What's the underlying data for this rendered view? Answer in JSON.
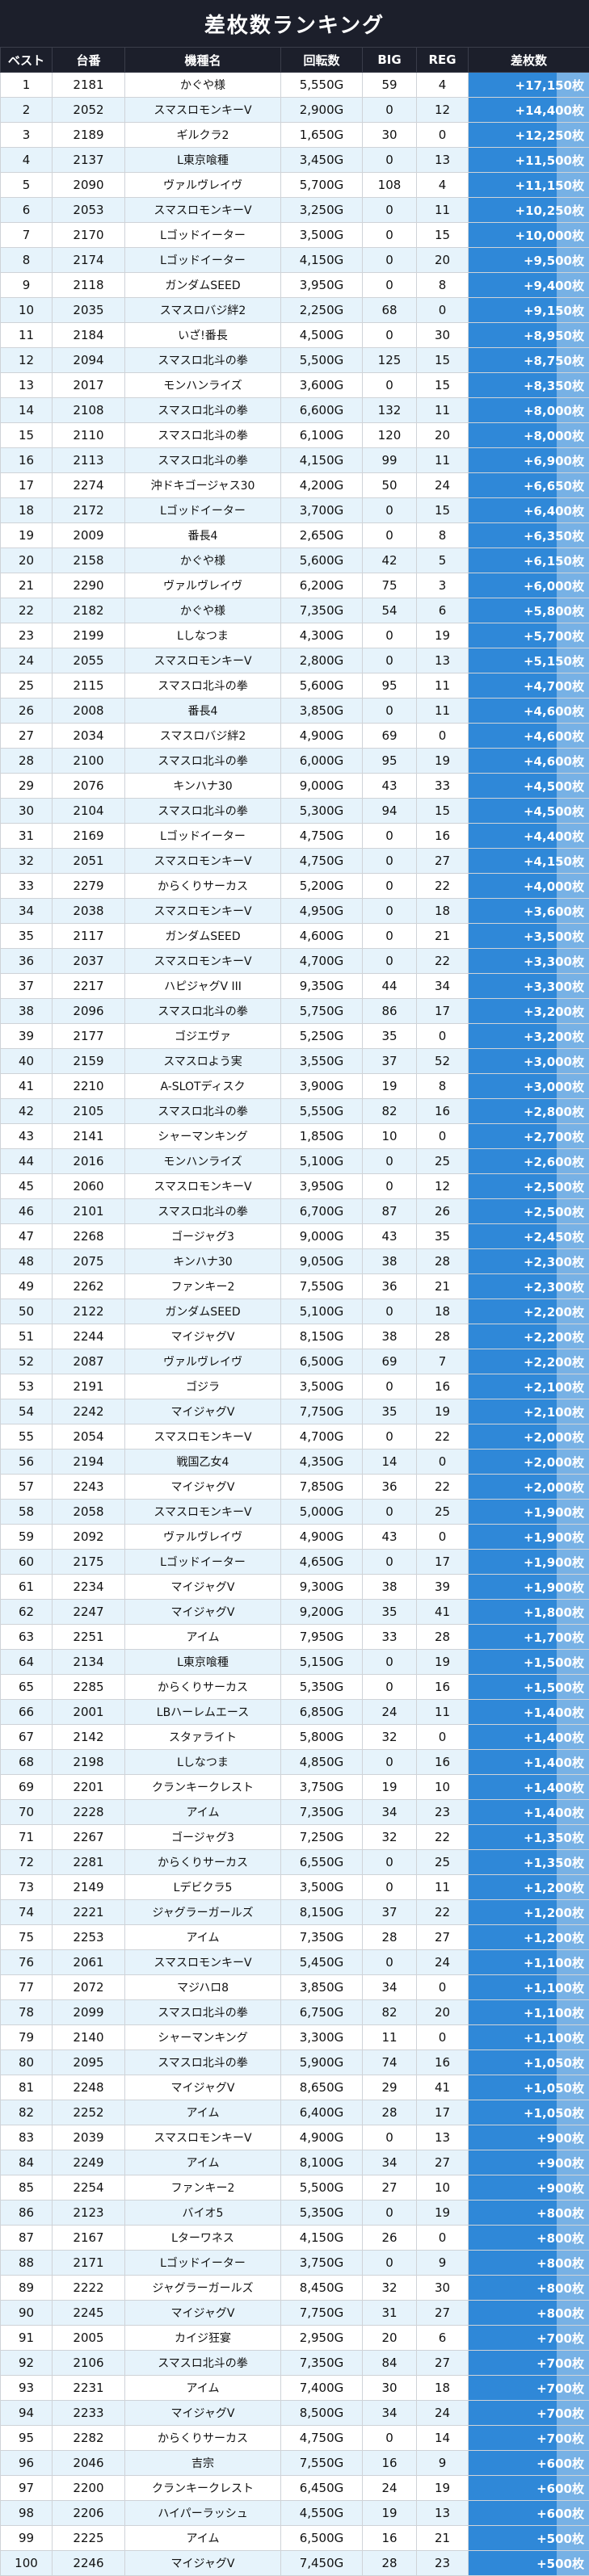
{
  "title": "差枚数ランキング",
  "columns": [
    "ベスト",
    "台番",
    "機種名",
    "回転数",
    "BIG",
    "REG",
    "差枚数"
  ],
  "rows": [
    [
      "1",
      "2181",
      "かぐや様",
      "5,550G",
      "59",
      "4",
      "+17,150枚"
    ],
    [
      "2",
      "2052",
      "スマスロモンキーV",
      "2,900G",
      "0",
      "12",
      "+14,400枚"
    ],
    [
      "3",
      "2189",
      "ギルクラ2",
      "1,650G",
      "30",
      "0",
      "+12,250枚"
    ],
    [
      "4",
      "2137",
      "L東京喰種",
      "3,450G",
      "0",
      "13",
      "+11,500枚"
    ],
    [
      "5",
      "2090",
      "ヴァルヴレイヴ",
      "5,700G",
      "108",
      "4",
      "+11,150枚"
    ],
    [
      "6",
      "2053",
      "スマスロモンキーV",
      "3,250G",
      "0",
      "11",
      "+10,250枚"
    ],
    [
      "7",
      "2170",
      "Lゴッドイーター",
      "3,500G",
      "0",
      "15",
      "+10,000枚"
    ],
    [
      "8",
      "2174",
      "Lゴッドイーター",
      "4,150G",
      "0",
      "20",
      "+9,500枚"
    ],
    [
      "9",
      "2118",
      "ガンダムSEED",
      "3,950G",
      "0",
      "8",
      "+9,400枚"
    ],
    [
      "10",
      "2035",
      "スマスロバジ絆2",
      "2,250G",
      "68",
      "0",
      "+9,150枚"
    ],
    [
      "11",
      "2184",
      "いざ!番長",
      "4,500G",
      "0",
      "30",
      "+8,950枚"
    ],
    [
      "12",
      "2094",
      "スマスロ北斗の拳",
      "5,500G",
      "125",
      "15",
      "+8,750枚"
    ],
    [
      "13",
      "2017",
      "モンハンライズ",
      "3,600G",
      "0",
      "15",
      "+8,350枚"
    ],
    [
      "14",
      "2108",
      "スマスロ北斗の拳",
      "6,600G",
      "132",
      "11",
      "+8,000枚"
    ],
    [
      "15",
      "2110",
      "スマスロ北斗の拳",
      "6,100G",
      "120",
      "20",
      "+8,000枚"
    ],
    [
      "16",
      "2113",
      "スマスロ北斗の拳",
      "4,150G",
      "99",
      "11",
      "+6,900枚"
    ],
    [
      "17",
      "2274",
      "沖ドキゴージャス30",
      "4,200G",
      "50",
      "24",
      "+6,650枚"
    ],
    [
      "18",
      "2172",
      "Lゴッドイーター",
      "3,700G",
      "0",
      "15",
      "+6,400枚"
    ],
    [
      "19",
      "2009",
      "番長4",
      "2,650G",
      "0",
      "8",
      "+6,350枚"
    ],
    [
      "20",
      "2158",
      "かぐや様",
      "5,600G",
      "42",
      "5",
      "+6,150枚"
    ],
    [
      "21",
      "2290",
      "ヴァルヴレイヴ",
      "6,200G",
      "75",
      "3",
      "+6,000枚"
    ],
    [
      "22",
      "2182",
      "かぐや様",
      "7,350G",
      "54",
      "6",
      "+5,800枚"
    ],
    [
      "23",
      "2199",
      "Lしなつま",
      "4,300G",
      "0",
      "19",
      "+5,700枚"
    ],
    [
      "24",
      "2055",
      "スマスロモンキーV",
      "2,800G",
      "0",
      "13",
      "+5,150枚"
    ],
    [
      "25",
      "2115",
      "スマスロ北斗の拳",
      "5,600G",
      "95",
      "11",
      "+4,700枚"
    ],
    [
      "26",
      "2008",
      "番長4",
      "3,850G",
      "0",
      "11",
      "+4,600枚"
    ],
    [
      "27",
      "2034",
      "スマスロバジ絆2",
      "4,900G",
      "69",
      "0",
      "+4,600枚"
    ],
    [
      "28",
      "2100",
      "スマスロ北斗の拳",
      "6,000G",
      "95",
      "19",
      "+4,600枚"
    ],
    [
      "29",
      "2076",
      "キンハナ30",
      "9,000G",
      "43",
      "33",
      "+4,500枚"
    ],
    [
      "30",
      "2104",
      "スマスロ北斗の拳",
      "5,300G",
      "94",
      "15",
      "+4,500枚"
    ],
    [
      "31",
      "2169",
      "Lゴッドイーター",
      "4,750G",
      "0",
      "16",
      "+4,400枚"
    ],
    [
      "32",
      "2051",
      "スマスロモンキーV",
      "4,750G",
      "0",
      "27",
      "+4,150枚"
    ],
    [
      "33",
      "2279",
      "からくりサーカス",
      "5,200G",
      "0",
      "22",
      "+4,000枚"
    ],
    [
      "34",
      "2038",
      "スマスロモンキーV",
      "4,950G",
      "0",
      "18",
      "+3,600枚"
    ],
    [
      "35",
      "2117",
      "ガンダムSEED",
      "4,600G",
      "0",
      "21",
      "+3,500枚"
    ],
    [
      "36",
      "2037",
      "スマスロモンキーV",
      "4,700G",
      "0",
      "22",
      "+3,300枚"
    ],
    [
      "37",
      "2217",
      "ハピジャグV III",
      "9,350G",
      "44",
      "34",
      "+3,300枚"
    ],
    [
      "38",
      "2096",
      "スマスロ北斗の拳",
      "5,750G",
      "86",
      "17",
      "+3,200枚"
    ],
    [
      "39",
      "2177",
      "ゴジエヴァ",
      "5,250G",
      "35",
      "0",
      "+3,200枚"
    ],
    [
      "40",
      "2159",
      "スマスロよう実",
      "3,550G",
      "37",
      "52",
      "+3,000枚"
    ],
    [
      "41",
      "2210",
      "A-SLOTディスク",
      "3,900G",
      "19",
      "8",
      "+3,000枚"
    ],
    [
      "42",
      "2105",
      "スマスロ北斗の拳",
      "5,550G",
      "82",
      "16",
      "+2,800枚"
    ],
    [
      "43",
      "2141",
      "シャーマンキング",
      "1,850G",
      "10",
      "0",
      "+2,700枚"
    ],
    [
      "44",
      "2016",
      "モンハンライズ",
      "5,100G",
      "0",
      "25",
      "+2,600枚"
    ],
    [
      "45",
      "2060",
      "スマスロモンキーV",
      "3,950G",
      "0",
      "12",
      "+2,500枚"
    ],
    [
      "46",
      "2101",
      "スマスロ北斗の拳",
      "6,700G",
      "87",
      "26",
      "+2,500枚"
    ],
    [
      "47",
      "2268",
      "ゴージャグ3",
      "9,000G",
      "43",
      "35",
      "+2,450枚"
    ],
    [
      "48",
      "2075",
      "キンハナ30",
      "9,050G",
      "38",
      "28",
      "+2,300枚"
    ],
    [
      "49",
      "2262",
      "ファンキー2",
      "7,550G",
      "36",
      "21",
      "+2,300枚"
    ],
    [
      "50",
      "2122",
      "ガンダムSEED",
      "5,100G",
      "0",
      "18",
      "+2,200枚"
    ],
    [
      "51",
      "2244",
      "マイジャグV",
      "8,150G",
      "38",
      "28",
      "+2,200枚"
    ],
    [
      "52",
      "2087",
      "ヴァルヴレイヴ",
      "6,500G",
      "69",
      "7",
      "+2,200枚"
    ],
    [
      "53",
      "2191",
      "ゴジラ",
      "3,500G",
      "0",
      "16",
      "+2,100枚"
    ],
    [
      "54",
      "2242",
      "マイジャグV",
      "7,750G",
      "35",
      "19",
      "+2,100枚"
    ],
    [
      "55",
      "2054",
      "スマスロモンキーV",
      "4,700G",
      "0",
      "22",
      "+2,000枚"
    ],
    [
      "56",
      "2194",
      "戦国乙女4",
      "4,350G",
      "14",
      "0",
      "+2,000枚"
    ],
    [
      "57",
      "2243",
      "マイジャグV",
      "7,850G",
      "36",
      "22",
      "+2,000枚"
    ],
    [
      "58",
      "2058",
      "スマスロモンキーV",
      "5,000G",
      "0",
      "25",
      "+1,900枚"
    ],
    [
      "59",
      "2092",
      "ヴァルヴレイヴ",
      "4,900G",
      "43",
      "0",
      "+1,900枚"
    ],
    [
      "60",
      "2175",
      "Lゴッドイーター",
      "4,650G",
      "0",
      "17",
      "+1,900枚"
    ],
    [
      "61",
      "2234",
      "マイジャグV",
      "9,300G",
      "38",
      "39",
      "+1,900枚"
    ],
    [
      "62",
      "2247",
      "マイジャグV",
      "9,200G",
      "35",
      "41",
      "+1,800枚"
    ],
    [
      "63",
      "2251",
      "アイム",
      "7,950G",
      "33",
      "28",
      "+1,700枚"
    ],
    [
      "64",
      "2134",
      "L東京喰種",
      "5,150G",
      "0",
      "19",
      "+1,500枚"
    ],
    [
      "65",
      "2285",
      "からくりサーカス",
      "5,350G",
      "0",
      "16",
      "+1,500枚"
    ],
    [
      "66",
      "2001",
      "LBハーレムエース",
      "6,850G",
      "24",
      "11",
      "+1,400枚"
    ],
    [
      "67",
      "2142",
      "スタァライト",
      "5,800G",
      "32",
      "0",
      "+1,400枚"
    ],
    [
      "68",
      "2198",
      "Lしなつま",
      "4,850G",
      "0",
      "16",
      "+1,400枚"
    ],
    [
      "69",
      "2201",
      "クランキークレスト",
      "3,750G",
      "19",
      "10",
      "+1,400枚"
    ],
    [
      "70",
      "2228",
      "アイム",
      "7,350G",
      "34",
      "23",
      "+1,400枚"
    ],
    [
      "71",
      "2267",
      "ゴージャグ3",
      "7,250G",
      "32",
      "22",
      "+1,350枚"
    ],
    [
      "72",
      "2281",
      "からくりサーカス",
      "6,550G",
      "0",
      "25",
      "+1,350枚"
    ],
    [
      "73",
      "2149",
      "Lデビクラ5",
      "3,500G",
      "0",
      "11",
      "+1,200枚"
    ],
    [
      "74",
      "2221",
      "ジャグラーガールズ",
      "8,150G",
      "37",
      "22",
      "+1,200枚"
    ],
    [
      "75",
      "2253",
      "アイム",
      "7,350G",
      "28",
      "27",
      "+1,200枚"
    ],
    [
      "76",
      "2061",
      "スマスロモンキーV",
      "5,450G",
      "0",
      "24",
      "+1,100枚"
    ],
    [
      "77",
      "2072",
      "マジハロ8",
      "3,850G",
      "34",
      "0",
      "+1,100枚"
    ],
    [
      "78",
      "2099",
      "スマスロ北斗の拳",
      "6,750G",
      "82",
      "20",
      "+1,100枚"
    ],
    [
      "79",
      "2140",
      "シャーマンキング",
      "3,300G",
      "11",
      "0",
      "+1,100枚"
    ],
    [
      "80",
      "2095",
      "スマスロ北斗の拳",
      "5,900G",
      "74",
      "16",
      "+1,050枚"
    ],
    [
      "81",
      "2248",
      "マイジャグV",
      "8,650G",
      "29",
      "41",
      "+1,050枚"
    ],
    [
      "82",
      "2252",
      "アイム",
      "6,400G",
      "28",
      "17",
      "+1,050枚"
    ],
    [
      "83",
      "2039",
      "スマスロモンキーV",
      "4,900G",
      "0",
      "13",
      "+900枚"
    ],
    [
      "84",
      "2249",
      "アイム",
      "8,100G",
      "34",
      "27",
      "+900枚"
    ],
    [
      "85",
      "2254",
      "ファンキー2",
      "5,500G",
      "27",
      "10",
      "+900枚"
    ],
    [
      "86",
      "2123",
      "バイオ5",
      "5,350G",
      "0",
      "19",
      "+800枚"
    ],
    [
      "87",
      "2167",
      "Lターワネス",
      "4,150G",
      "26",
      "0",
      "+800枚"
    ],
    [
      "88",
      "2171",
      "Lゴッドイーター",
      "3,750G",
      "0",
      "9",
      "+800枚"
    ],
    [
      "89",
      "2222",
      "ジャグラーガールズ",
      "8,450G",
      "32",
      "30",
      "+800枚"
    ],
    [
      "90",
      "2245",
      "マイジャグV",
      "7,750G",
      "31",
      "27",
      "+800枚"
    ],
    [
      "91",
      "2005",
      "カイジ狂宴",
      "2,950G",
      "20",
      "6",
      "+700枚"
    ],
    [
      "92",
      "2106",
      "スマスロ北斗の拳",
      "7,350G",
      "84",
      "27",
      "+700枚"
    ],
    [
      "93",
      "2231",
      "アイム",
      "7,400G",
      "30",
      "18",
      "+700枚"
    ],
    [
      "94",
      "2233",
      "マイジャグV",
      "8,500G",
      "34",
      "24",
      "+700枚"
    ],
    [
      "95",
      "2282",
      "からくりサーカス",
      "4,750G",
      "0",
      "14",
      "+700枚"
    ],
    [
      "96",
      "2046",
      "吉宗",
      "7,550G",
      "16",
      "9",
      "+600枚"
    ],
    [
      "97",
      "2200",
      "クランキークレスト",
      "6,450G",
      "24",
      "19",
      "+600枚"
    ],
    [
      "98",
      "2206",
      "ハイパーラッシュ",
      "4,550G",
      "19",
      "13",
      "+600枚"
    ],
    [
      "99",
      "2225",
      "アイム",
      "6,500G",
      "16",
      "21",
      "+500枚"
    ],
    [
      "100",
      "2246",
      "マイジャグV",
      "7,450G",
      "28",
      "23",
      "+500枚"
    ]
  ]
}
